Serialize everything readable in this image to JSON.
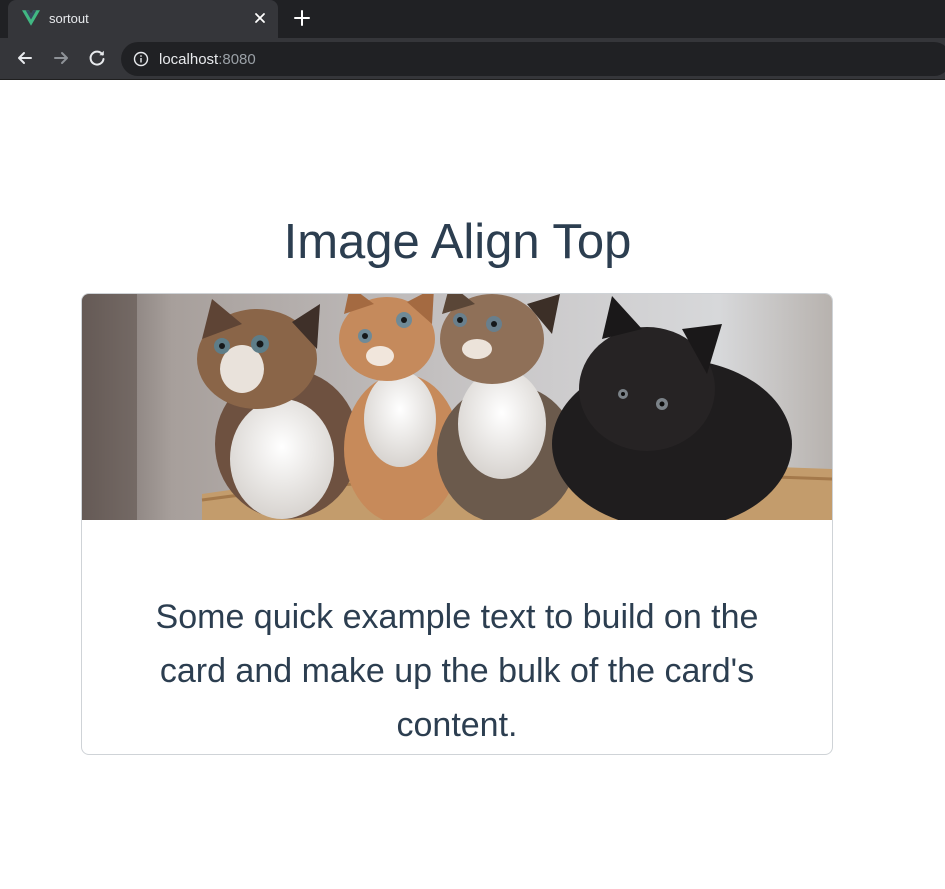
{
  "browser": {
    "tab": {
      "title": "sortout",
      "favicon": "vue-logo-icon",
      "close_icon": "close-icon"
    },
    "new_tab_icon": "plus-icon",
    "nav": {
      "back_icon": "arrow-left-icon",
      "forward_icon": "arrow-right-icon",
      "reload_icon": "reload-icon"
    },
    "address": {
      "host": "localhost",
      "port": ":8080",
      "info_icon": "info-icon"
    }
  },
  "page": {
    "heading": "Image Align Top",
    "card": {
      "image": "kittens-photo",
      "text": "Some quick example text to build on the card and make up the bulk of the card's content."
    }
  },
  "colors": {
    "text": "#2c3e50",
    "tabbar": "#202124",
    "toolbar": "#35363a",
    "vue_green": "#41b883",
    "vue_dark": "#35495e"
  }
}
